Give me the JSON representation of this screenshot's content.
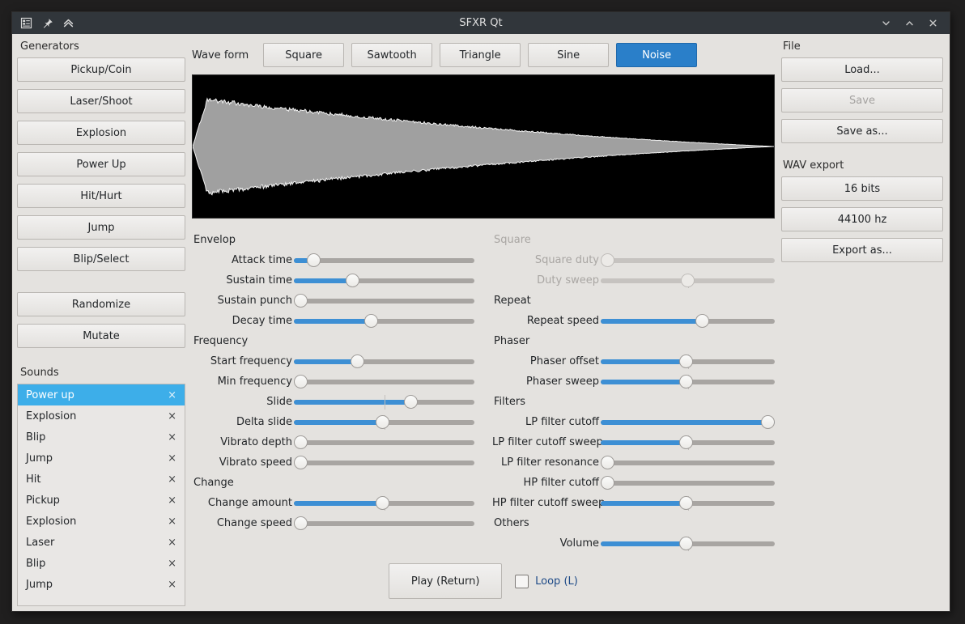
{
  "window": {
    "title": "SFXR Qt",
    "titlebar_icons": [
      "menu-icon",
      "pin-icon",
      "collapse-icon"
    ],
    "controls": [
      "minimize",
      "maximize",
      "close"
    ]
  },
  "generators": {
    "title": "Generators",
    "buttons": [
      "Pickup/Coin",
      "Laser/Shoot",
      "Explosion",
      "Power Up",
      "Hit/Hurt",
      "Jump",
      "Blip/Select"
    ],
    "extra_buttons": [
      "Randomize",
      "Mutate"
    ]
  },
  "sounds": {
    "title": "Sounds",
    "delete_glyph": "×",
    "items": [
      {
        "name": "Power up",
        "selected": true
      },
      {
        "name": "Explosion",
        "selected": false
      },
      {
        "name": "Blip",
        "selected": false
      },
      {
        "name": "Jump",
        "selected": false
      },
      {
        "name": "Hit",
        "selected": false
      },
      {
        "name": "Pickup",
        "selected": false
      },
      {
        "name": "Explosion",
        "selected": false
      },
      {
        "name": "Laser",
        "selected": false
      },
      {
        "name": "Blip",
        "selected": false
      },
      {
        "name": "Jump",
        "selected": false
      }
    ]
  },
  "waveform": {
    "label": "Wave form",
    "options": [
      "Square",
      "Sawtooth",
      "Triangle",
      "Sine",
      "Noise"
    ],
    "selected": "Noise"
  },
  "file": {
    "title": "File",
    "buttons": [
      {
        "label": "Load...",
        "enabled": true
      },
      {
        "label": "Save",
        "enabled": false
      },
      {
        "label": "Save as...",
        "enabled": true
      }
    ]
  },
  "wav_export": {
    "title": "WAV export",
    "buttons": [
      {
        "label": "16 bits",
        "enabled": true
      },
      {
        "label": "44100 hz",
        "enabled": true
      },
      {
        "label": "Export as...",
        "enabled": true
      }
    ]
  },
  "playback": {
    "play_label": "Play (Return)",
    "loop_label": "Loop (L)",
    "loop_checked": false
  },
  "colors": {
    "accent_blue": "#3daee9",
    "button_blue": "#2a7fc9",
    "slider_blue": "#3d8fd4",
    "groove_gray": "#a8a5a2",
    "titlebar": "#31363b",
    "window_bg": "#e4e2df",
    "scope_bg": "#000000",
    "scope_wave": "#a0a0a0"
  },
  "params_left": [
    {
      "section": "Envelop",
      "enabled": true,
      "sliders": [
        {
          "label": "Attack time",
          "value": 0.08,
          "bipolar": false
        },
        {
          "label": "Sustain time",
          "value": 0.31,
          "bipolar": false
        },
        {
          "label": "Sustain punch",
          "value": 0.0,
          "bipolar": false
        },
        {
          "label": "Decay time",
          "value": 0.42,
          "bipolar": false
        }
      ]
    },
    {
      "section": "Frequency",
      "enabled": true,
      "sliders": [
        {
          "label": "Start frequency",
          "value": 0.34,
          "bipolar": false
        },
        {
          "label": "Min frequency",
          "value": 0.0,
          "bipolar": false
        },
        {
          "label": "Slide",
          "value": 0.66,
          "bipolar": true
        },
        {
          "label": "Delta slide",
          "value": 0.49,
          "bipolar": true
        },
        {
          "label": "Vibrato depth",
          "value": 0.0,
          "bipolar": false
        },
        {
          "label": "Vibrato speed",
          "value": 0.0,
          "bipolar": false
        }
      ]
    },
    {
      "section": "Change",
      "enabled": true,
      "sliders": [
        {
          "label": "Change amount",
          "value": 0.49,
          "bipolar": true
        },
        {
          "label": "Change speed",
          "value": 0.0,
          "bipolar": false
        }
      ]
    }
  ],
  "params_right": [
    {
      "section": "Square",
      "enabled": false,
      "sliders": [
        {
          "label": "Square duty",
          "value": 0.0,
          "bipolar": false
        },
        {
          "label": "Duty sweep",
          "value": 0.5,
          "bipolar": true
        }
      ]
    },
    {
      "section": "Repeat",
      "enabled": true,
      "sliders": [
        {
          "label": "Repeat speed",
          "value": 0.59,
          "bipolar": false
        }
      ]
    },
    {
      "section": "Phaser",
      "enabled": true,
      "sliders": [
        {
          "label": "Phaser offset",
          "value": 0.49,
          "bipolar": true
        },
        {
          "label": "Phaser sweep",
          "value": 0.49,
          "bipolar": true
        }
      ]
    },
    {
      "section": "Filters",
      "enabled": true,
      "sliders": [
        {
          "label": "LP filter cutoff",
          "value": 1.0,
          "bipolar": false
        },
        {
          "label": "LP filter cutoff sweep",
          "value": 0.49,
          "bipolar": true
        },
        {
          "label": "LP filter resonance",
          "value": 0.0,
          "bipolar": false
        },
        {
          "label": "HP filter cutoff",
          "value": 0.0,
          "bipolar": false
        },
        {
          "label": "HP filter cutoff sweep",
          "value": 0.49,
          "bipolar": true
        }
      ]
    },
    {
      "section": "Others",
      "enabled": true,
      "sliders": [
        {
          "label": "Volume",
          "value": 0.49,
          "bipolar": true
        }
      ]
    }
  ],
  "scope": {
    "description": "noise burst with decaying amplitude envelope",
    "attack_fraction": 0.025,
    "peak_amplitude": 0.62,
    "end_amplitude": 0.01
  }
}
